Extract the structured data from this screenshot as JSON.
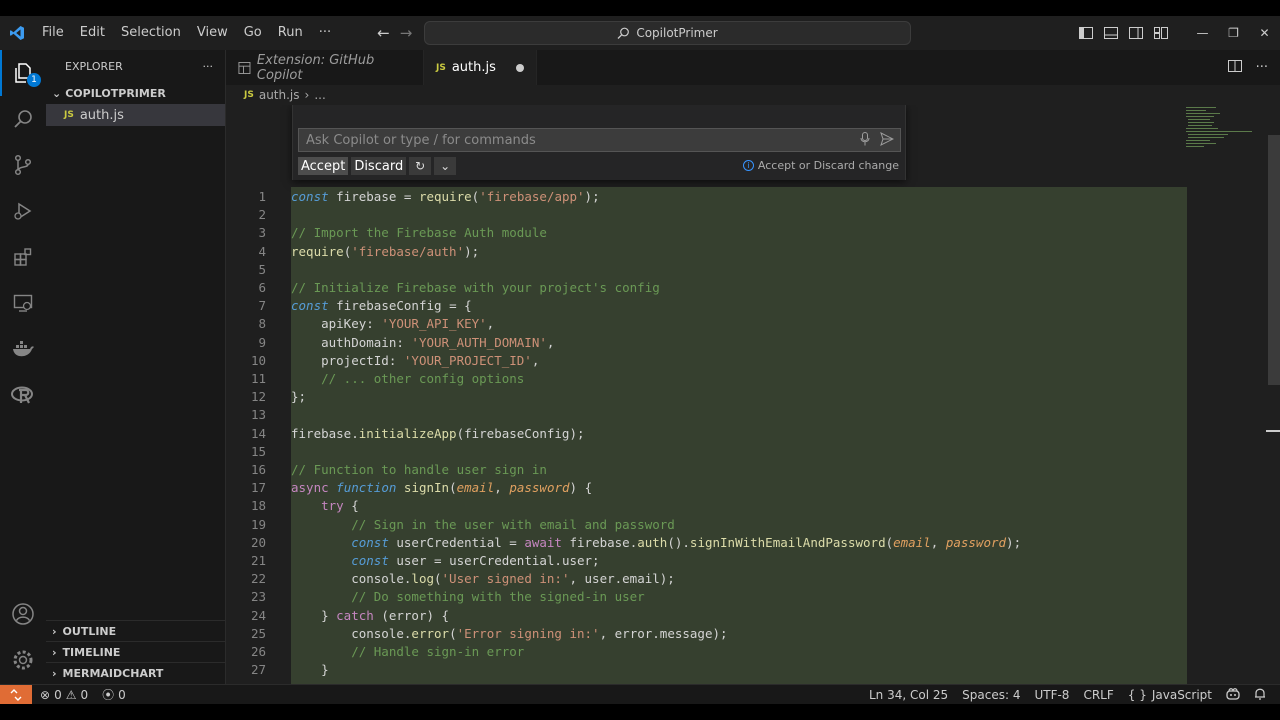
{
  "titlebar": {
    "menu": [
      "File",
      "Edit",
      "Selection",
      "View",
      "Go",
      "Run",
      "···"
    ],
    "search_text": "CopilotPrimer"
  },
  "sidebar": {
    "header": "EXPLORER",
    "folder": "COPILOTPRIMER",
    "files": [
      "auth.js"
    ],
    "sections": [
      "OUTLINE",
      "TIMELINE",
      "MERMAIDCHART"
    ],
    "explorer_badge": "1"
  },
  "tabs": [
    {
      "label": "Extension: GitHub Copilot",
      "active": false
    },
    {
      "label": "auth.js",
      "active": true,
      "dirty": true
    }
  ],
  "breadcrumb": {
    "file": "auth.js",
    "rest": "..."
  },
  "inline_chat": {
    "placeholder": "Ask Copilot or type / for commands",
    "accept_label": "Accept",
    "discard_label": "Discard",
    "status": "Accept or Discard change"
  },
  "code_lines": [
    {
      "n": "1",
      "parts": [
        [
          "kw",
          "const"
        ],
        [
          "op",
          " firebase "
        ],
        [
          "op",
          "= "
        ],
        [
          "fn",
          "require"
        ],
        [
          "op",
          "("
        ],
        [
          "str",
          "'firebase/app'"
        ],
        [
          "op",
          ");"
        ]
      ]
    },
    {
      "n": "2",
      "parts": []
    },
    {
      "n": "3",
      "parts": [
        [
          "cm",
          "// Import the Firebase Auth module"
        ]
      ]
    },
    {
      "n": "4",
      "parts": [
        [
          "fn",
          "require"
        ],
        [
          "op",
          "("
        ],
        [
          "str",
          "'firebase/auth'"
        ],
        [
          "op",
          ");"
        ]
      ]
    },
    {
      "n": "5",
      "parts": []
    },
    {
      "n": "6",
      "parts": [
        [
          "cm",
          "// Initialize Firebase with your project's config"
        ]
      ]
    },
    {
      "n": "7",
      "parts": [
        [
          "kw",
          "const"
        ],
        [
          "op",
          " firebaseConfig "
        ],
        [
          "op",
          "= {"
        ]
      ]
    },
    {
      "n": "8",
      "parts": [
        [
          "op",
          "    apiKey: "
        ],
        [
          "str",
          "'YOUR_API_KEY'"
        ],
        [
          "op",
          ","
        ]
      ]
    },
    {
      "n": "9",
      "parts": [
        [
          "op",
          "    authDomain: "
        ],
        [
          "str",
          "'YOUR_AUTH_DOMAIN'"
        ],
        [
          "op",
          ","
        ]
      ]
    },
    {
      "n": "10",
      "parts": [
        [
          "op",
          "    projectId: "
        ],
        [
          "str",
          "'YOUR_PROJECT_ID'"
        ],
        [
          "op",
          ","
        ]
      ]
    },
    {
      "n": "11",
      "parts": [
        [
          "cm",
          "    // ... other config options"
        ]
      ]
    },
    {
      "n": "12",
      "parts": [
        [
          "op",
          "};"
        ]
      ]
    },
    {
      "n": "13",
      "parts": []
    },
    {
      "n": "14",
      "parts": [
        [
          "op",
          "firebase."
        ],
        [
          "fn",
          "initializeApp"
        ],
        [
          "op",
          "(firebaseConfig);"
        ]
      ]
    },
    {
      "n": "15",
      "parts": []
    },
    {
      "n": "16",
      "parts": [
        [
          "cm",
          "// Function to handle user sign in"
        ]
      ]
    },
    {
      "n": "17",
      "parts": [
        [
          "kw2",
          "async"
        ],
        [
          "op",
          " "
        ],
        [
          "kw",
          "function"
        ],
        [
          "op",
          " "
        ],
        [
          "fn",
          "signIn"
        ],
        [
          "op",
          "("
        ],
        [
          "prm",
          "email"
        ],
        [
          "op",
          ", "
        ],
        [
          "prm",
          "password"
        ],
        [
          "op",
          ") {"
        ]
      ]
    },
    {
      "n": "18",
      "parts": [
        [
          "kw2",
          "    try"
        ],
        [
          "op",
          " {"
        ]
      ]
    },
    {
      "n": "19",
      "parts": [
        [
          "cm",
          "        // Sign in the user with email and password"
        ]
      ]
    },
    {
      "n": "20",
      "parts": [
        [
          "op",
          "        "
        ],
        [
          "kw",
          "const"
        ],
        [
          "op",
          " userCredential = "
        ],
        [
          "kw2",
          "await"
        ],
        [
          "op",
          " firebase."
        ],
        [
          "fn",
          "auth"
        ],
        [
          "op",
          "()."
        ],
        [
          "fn",
          "signInWithEmailAndPassword"
        ],
        [
          "op",
          "("
        ],
        [
          "prm",
          "email"
        ],
        [
          "op",
          ", "
        ],
        [
          "prm",
          "password"
        ],
        [
          "op",
          ");"
        ]
      ]
    },
    {
      "n": "21",
      "parts": [
        [
          "op",
          "        "
        ],
        [
          "kw",
          "const"
        ],
        [
          "op",
          " user = userCredential.user;"
        ]
      ]
    },
    {
      "n": "22",
      "parts": [
        [
          "op",
          "        console."
        ],
        [
          "fn",
          "log"
        ],
        [
          "op",
          "("
        ],
        [
          "str",
          "'User signed in:'"
        ],
        [
          "op",
          ", user.email);"
        ]
      ]
    },
    {
      "n": "23",
      "parts": [
        [
          "cm",
          "        // Do something with the signed-in user"
        ]
      ]
    },
    {
      "n": "24",
      "parts": [
        [
          "op",
          "    } "
        ],
        [
          "kw2",
          "catch"
        ],
        [
          "op",
          " (error) {"
        ]
      ]
    },
    {
      "n": "25",
      "parts": [
        [
          "op",
          "        console."
        ],
        [
          "fn",
          "error"
        ],
        [
          "op",
          "("
        ],
        [
          "str",
          "'Error signing in:'"
        ],
        [
          "op",
          ", error.message);"
        ]
      ]
    },
    {
      "n": "26",
      "parts": [
        [
          "cm",
          "        // Handle sign-in error"
        ]
      ]
    },
    {
      "n": "27",
      "parts": [
        [
          "op",
          "    }"
        ]
      ]
    }
  ],
  "statusbar": {
    "errors": "0",
    "warnings": "0",
    "ports": "0",
    "position": "Ln 34, Col 25",
    "spaces": "Spaces: 4",
    "encoding": "UTF-8",
    "eol": "CRLF",
    "language": "JavaScript",
    "language_prefix": "{ }"
  },
  "colors": {
    "accent": "#0078d4",
    "remote": "#e06c35",
    "diff_bg": "#36402f"
  }
}
